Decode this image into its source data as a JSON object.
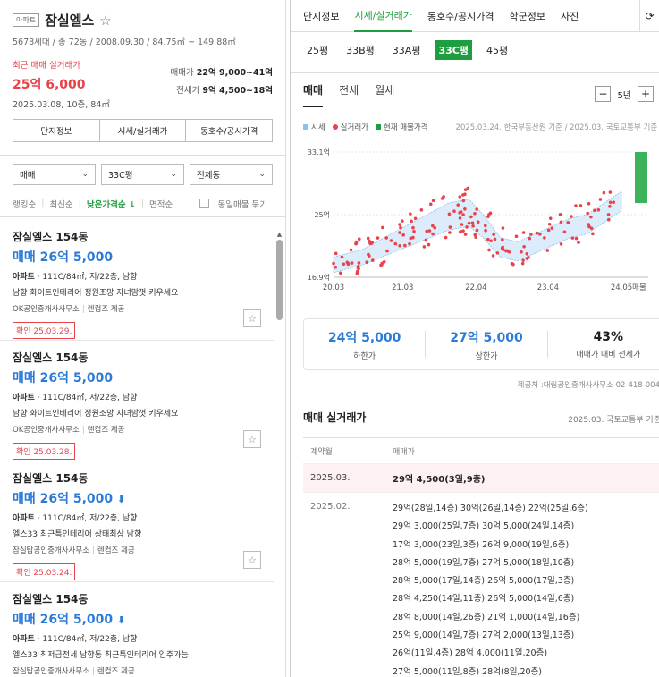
{
  "complex": {
    "badge": "아파트",
    "name": "잠실엘스",
    "star": "☆",
    "meta": "5678세대 / 총 72동 / 2008.09.30 / 84.75㎡ ~ 149.88㎡",
    "recent_label": "최근 매매 실거래가",
    "recent_price": "25억 6,000",
    "recent_date": "2025.03.08, 10층, 84㎡",
    "sale_label": "매매가",
    "sale_range": "22억 9,000~41억",
    "rent_label": "전세가",
    "rent_range": "9억 4,500~18억",
    "buttons": [
      "단지정보",
      "시세/실거래가",
      "동호수/공시가격"
    ]
  },
  "filters": [
    "매매",
    "33C평",
    "전체동"
  ],
  "sort": {
    "items": [
      "랭킹순",
      "최신순",
      "낮은가격순 ↓",
      "면적순"
    ],
    "same_listing": "동일매물 묶기"
  },
  "listings": [
    {
      "title": "잠실엘스 154동",
      "price": "매매 26억 5,000",
      "arrow": "",
      "type": "아파트",
      "spec": " · 111C/84㎡, 저/22층, 남향",
      "desc": "남향 화이트인테리어 정원조망 자녀맘껏 키우세요",
      "agent": "OK공인중개사사무소",
      "provider": "렌컴즈 제공",
      "confirm": "확인 25.03.29."
    },
    {
      "title": "잠실엘스 154동",
      "price": "매매 26억 5,000",
      "arrow": "",
      "type": "아파트",
      "spec": " · 111C/84㎡, 저/22층, 남향",
      "desc": "남향 화이트인테리어 정원조망 자녀맘껏 키우세요",
      "agent": "OK공인중개사사무소",
      "provider": "렌컴즈 제공",
      "confirm": "확인 25.03.28."
    },
    {
      "title": "잠실엘스 154동",
      "price": "매매 26억 5,000",
      "arrow": "⬇",
      "type": "아파트",
      "spec": " · 111C/84㎡, 저/22층, 남향",
      "desc": "엘스33 최근특인테리어 상태최상 남향",
      "agent": "잠실탑공인중개사사무소",
      "provider": "렌컴즈 제공",
      "confirm": "확인 25.03.24."
    },
    {
      "title": "잠실엘스 154동",
      "price": "매매 26억 5,000",
      "arrow": "⬇",
      "type": "아파트",
      "spec": " · 111C/84㎡, 저/22층, 남향",
      "desc": "엘스33 최저급전세 남향동 최근특인테리어 입주가능",
      "agent": "잠실탑공인중개사사무소",
      "provider": "렌컴즈 제공",
      "confirm": ""
    }
  ],
  "tabs": [
    "단지정보",
    "시세/실거래가",
    "동호수/공시가격",
    "학군정보",
    "사진"
  ],
  "pyeong": [
    "25평",
    "33B평",
    "33A평",
    "33C평",
    "45평"
  ],
  "deal_tabs": [
    "매매",
    "전세",
    "월세"
  ],
  "period": {
    "minus": "−",
    "value": "5년",
    "plus": "+"
  },
  "legend": {
    "market": "시세",
    "actual": "실거래가",
    "current": "현재 매물가격",
    "source": "2025.03.24. 한국부동산원 기준 / 2025.03. 국토교통부 기준"
  },
  "chart_data": {
    "type": "scatter",
    "y_ticks": [
      "33.1억",
      "25억",
      "16.9억"
    ],
    "x_ticks": [
      "20.03",
      "21.03",
      "22.04",
      "23.04",
      "24.05",
      "매물"
    ],
    "ylim": [
      16.9,
      33.1
    ],
    "series": [
      {
        "name": "시세",
        "type": "area"
      },
      {
        "name": "실거래가",
        "type": "scatter"
      },
      {
        "name": "현재 매물가격",
        "type": "bar"
      }
    ]
  },
  "stats": {
    "low": {
      "value": "24억 5,000",
      "label": "하한가"
    },
    "high": {
      "value": "27억 5,000",
      "label": "상한가"
    },
    "ratio": {
      "value": "43%",
      "label": "매매가 대비 전세가"
    }
  },
  "provider": "제공처 :대림공인중개사사무소 02-418-004",
  "trades": {
    "title": "매매 실거래가",
    "source": "2025.03. 국토교통부 기준",
    "col_date": "계약월",
    "col_price": "매매가",
    "top": {
      "month": "2025.03.",
      "value": "29억 4,500(3일,9층)"
    },
    "month2": "2025.02.",
    "lines": [
      "29억(28일,14층)      30억(26일,14층)      22억(25일,6층)",
      "29억 3,000(25일,7층)      30억 5,000(24일,14층)",
      "17억 3,000(23일,3층)      26억 9,000(19일,6층)",
      "28억 5,000(19일,7층)      27억 5,000(18일,10층)",
      "28억 5,000(17일,14층)      26억 5,000(17일,3층)",
      "28억 4,250(14일,11층)      26억 5,000(14일,6층)",
      "28억 8,000(14일,26층)      21억 1,000(14일,16층)",
      "25억 9,000(14일,7층)      27억 2,000(13일,13층)",
      "26억(11일,4층)      28억 4,000(11일,20층)",
      "27억 5,000(11일,8층)      28억(8일,20층)"
    ]
  }
}
